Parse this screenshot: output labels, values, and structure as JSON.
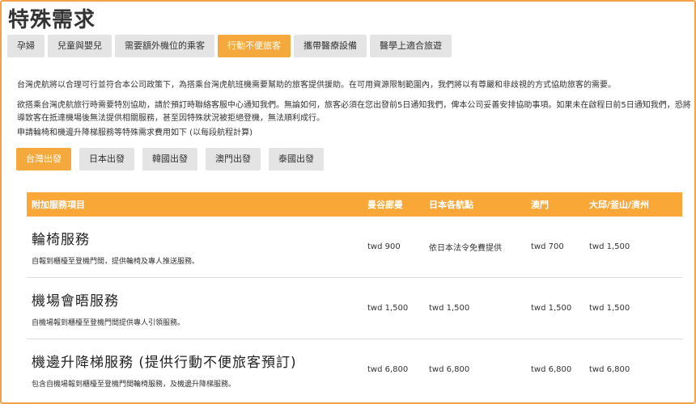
{
  "title": "特殊需求",
  "main_tabs": [
    {
      "label": "孕婦"
    },
    {
      "label": "兒童與嬰兒"
    },
    {
      "label": "需要額外機位的乘客"
    },
    {
      "label": "行動不便旅客"
    },
    {
      "label": "攜帶醫療設備"
    },
    {
      "label": "醫學上適合旅遊"
    }
  ],
  "main_active": "行動不便旅客",
  "paragraphs": [
    "台灣虎航將以合理可行並符合本公司政策下，為搭乘台灣虎航班機需要幫助的旅客提供援助。在可用資源限制範圍內，我們將以有尊嚴和非歧視的方式協助旅客的需要。",
    "欲搭乘台灣虎航旅行時需要特別協助，請於預訂時聯絡客服中心通知我們。無論如何，旅客必須在您出發前5日通知我們，俾本公司妥善安排協助事項。如果未在啟程日前5日通知我們，恐將導致客在抵達機場後無法提供相關服務，甚至因特殊狀況被拒絕登機，無法順利成行。",
    "申請輪椅和機邊升降梯服務等特殊需求費用如下 (以每段航程計算)"
  ],
  "departure_tabs": [
    {
      "label": "台灣出發"
    },
    {
      "label": "日本出發"
    },
    {
      "label": "韓國出發"
    },
    {
      "label": "澳門出發"
    },
    {
      "label": "泰國出發"
    }
  ],
  "departure_active": "台灣出發",
  "table": {
    "headers": [
      "附加服務項目",
      "曼谷廊曼",
      "日本各航點",
      "澳門",
      "大邱/釜山/濟州"
    ],
    "rows": [
      {
        "name": "輪椅服務",
        "desc": "自報到櫃檯至登機門間，提供輪椅及專人推送服務。",
        "prices": [
          "twd 900",
          "依日本法令免費提供",
          "twd 700",
          "twd 1,500"
        ]
      },
      {
        "name": "機場會晤服務",
        "desc": "自機場報到櫃檯至登機門間提供專人引領服務。",
        "prices": [
          "twd 1,500",
          "twd 1,500",
          "twd 1,500",
          "twd 1,500"
        ]
      },
      {
        "name": "機邊升降梯服務 (提供行動不便旅客預訂)",
        "desc": "包含自機場報到櫃檯至登機門間輪椅服務，及機邊升降梯服務。",
        "prices": [
          "twd 6,800",
          "twd 6,800",
          "twd 6,800",
          "twd 6,800"
        ]
      }
    ]
  },
  "colors": {
    "accent": "#f5a83c",
    "frame": "#f4a14a",
    "tab_bg": "#e4e4e4"
  }
}
